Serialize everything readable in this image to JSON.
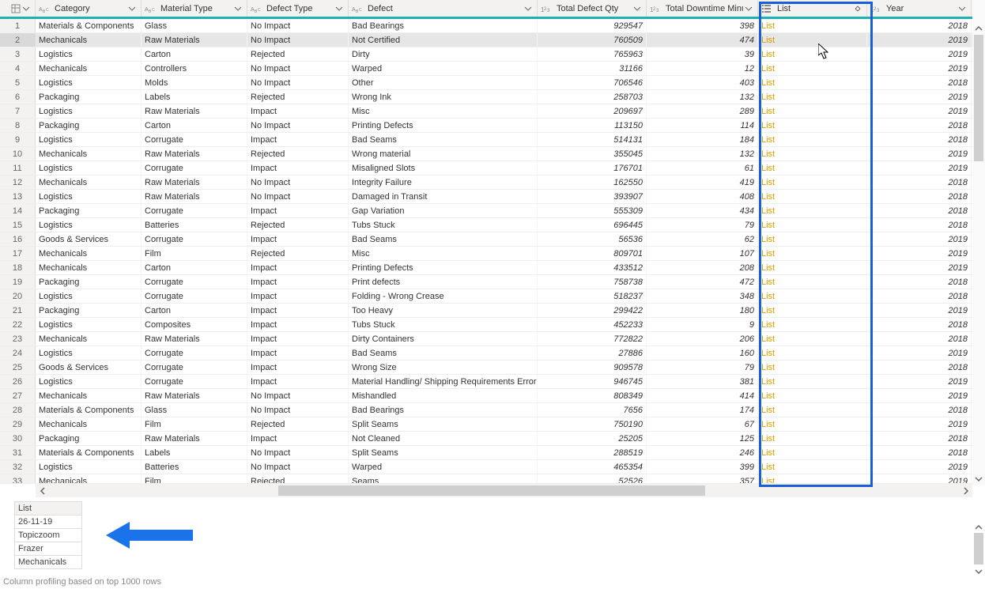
{
  "columns": {
    "category": "Category",
    "material": "Material Type",
    "defect_type": "Defect Type",
    "defect": "Defect",
    "qty": "Total Defect Qty",
    "downtime": "Total Downtime Minutes",
    "list": "List",
    "year": "Year"
  },
  "type_icon_text": {
    "text": "ABC",
    "num": "123",
    "list": "list"
  },
  "rows": [
    {
      "n": 1,
      "category": "Materials & Components",
      "material": "Glass",
      "defect_type": "No Impact",
      "defect": "Bad Bearings",
      "qty": "929547",
      "downtime": "398",
      "list": "List",
      "year": "2018"
    },
    {
      "n": 2,
      "category": "Mechanicals",
      "material": "Raw Materials",
      "defect_type": "No Impact",
      "defect": "Not Certified",
      "qty": "760509",
      "downtime": "474",
      "list": "List",
      "year": "2019"
    },
    {
      "n": 3,
      "category": "Logistics",
      "material": "Carton",
      "defect_type": "Rejected",
      "defect": "Dirty",
      "qty": "765963",
      "downtime": "39",
      "list": "List",
      "year": "2019"
    },
    {
      "n": 4,
      "category": "Mechanicals",
      "material": "Controllers",
      "defect_type": "No Impact",
      "defect": "Warped",
      "qty": "31166",
      "downtime": "12",
      "list": "List",
      "year": "2019"
    },
    {
      "n": 5,
      "category": "Logistics",
      "material": "Molds",
      "defect_type": "No Impact",
      "defect": "Other",
      "qty": "706546",
      "downtime": "403",
      "list": "List",
      "year": "2018"
    },
    {
      "n": 6,
      "category": "Packaging",
      "material": "Labels",
      "defect_type": "Rejected",
      "defect": "Wrong Ink",
      "qty": "258703",
      "downtime": "132",
      "list": "List",
      "year": "2019"
    },
    {
      "n": 7,
      "category": "Logistics",
      "material": "Raw Materials",
      "defect_type": "Impact",
      "defect": "Misc",
      "qty": "209697",
      "downtime": "289",
      "list": "List",
      "year": "2019"
    },
    {
      "n": 8,
      "category": "Packaging",
      "material": "Carton",
      "defect_type": "No Impact",
      "defect": "Printing Defects",
      "qty": "113150",
      "downtime": "114",
      "list": "List",
      "year": "2018"
    },
    {
      "n": 9,
      "category": "Logistics",
      "material": "Corrugate",
      "defect_type": "Impact",
      "defect": "Bad Seams",
      "qty": "514131",
      "downtime": "184",
      "list": "List",
      "year": "2018"
    },
    {
      "n": 10,
      "category": "Mechanicals",
      "material": "Raw Materials",
      "defect_type": "Rejected",
      "defect": "Wrong material",
      "qty": "355045",
      "downtime": "132",
      "list": "List",
      "year": "2019"
    },
    {
      "n": 11,
      "category": "Logistics",
      "material": "Corrugate",
      "defect_type": "Impact",
      "defect": "Misaligned Slots",
      "qty": "176701",
      "downtime": "61",
      "list": "List",
      "year": "2019"
    },
    {
      "n": 12,
      "category": "Mechanicals",
      "material": "Raw Materials",
      "defect_type": "No Impact",
      "defect": "Integrity Failure",
      "qty": "162550",
      "downtime": "419",
      "list": "List",
      "year": "2018"
    },
    {
      "n": 13,
      "category": "Logistics",
      "material": "Raw Materials",
      "defect_type": "No Impact",
      "defect": "Damaged in Transit",
      "qty": "393907",
      "downtime": "408",
      "list": "List",
      "year": "2018"
    },
    {
      "n": 14,
      "category": "Packaging",
      "material": "Corrugate",
      "defect_type": "Impact",
      "defect": "Gap Variation",
      "qty": "555309",
      "downtime": "434",
      "list": "List",
      "year": "2018"
    },
    {
      "n": 15,
      "category": "Logistics",
      "material": "Batteries",
      "defect_type": "Rejected",
      "defect": "Tubs Stuck",
      "qty": "696445",
      "downtime": "79",
      "list": "List",
      "year": "2018"
    },
    {
      "n": 16,
      "category": "Goods & Services",
      "material": "Corrugate",
      "defect_type": "Impact",
      "defect": "Bad Seams",
      "qty": "56536",
      "downtime": "62",
      "list": "List",
      "year": "2019"
    },
    {
      "n": 17,
      "category": "Mechanicals",
      "material": "Film",
      "defect_type": "Rejected",
      "defect": "Misc",
      "qty": "809701",
      "downtime": "107",
      "list": "List",
      "year": "2019"
    },
    {
      "n": 18,
      "category": "Mechanicals",
      "material": "Carton",
      "defect_type": "Impact",
      "defect": "Printing Defects",
      "qty": "433512",
      "downtime": "208",
      "list": "List",
      "year": "2019"
    },
    {
      "n": 19,
      "category": "Packaging",
      "material": "Corrugate",
      "defect_type": "Impact",
      "defect": "Print defects",
      "qty": "758738",
      "downtime": "472",
      "list": "List",
      "year": "2018"
    },
    {
      "n": 20,
      "category": "Logistics",
      "material": "Corrugate",
      "defect_type": "Impact",
      "defect": "Folding - Wrong Crease",
      "qty": "518237",
      "downtime": "348",
      "list": "List",
      "year": "2018"
    },
    {
      "n": 21,
      "category": "Packaging",
      "material": "Carton",
      "defect_type": "Impact",
      "defect": "Too Heavy",
      "qty": "299422",
      "downtime": "180",
      "list": "List",
      "year": "2019"
    },
    {
      "n": 22,
      "category": "Logistics",
      "material": "Composites",
      "defect_type": "Impact",
      "defect": "Tubs Stuck",
      "qty": "452233",
      "downtime": "9",
      "list": "List",
      "year": "2018"
    },
    {
      "n": 23,
      "category": "Mechanicals",
      "material": "Raw Materials",
      "defect_type": "Impact",
      "defect": "Dirty Containers",
      "qty": "772822",
      "downtime": "206",
      "list": "List",
      "year": "2018"
    },
    {
      "n": 24,
      "category": "Logistics",
      "material": "Corrugate",
      "defect_type": "Impact",
      "defect": "Bad Seams",
      "qty": "27886",
      "downtime": "160",
      "list": "List",
      "year": "2019"
    },
    {
      "n": 25,
      "category": "Goods & Services",
      "material": "Corrugate",
      "defect_type": "Impact",
      "defect": "Wrong  Size",
      "qty": "909578",
      "downtime": "79",
      "list": "List",
      "year": "2018"
    },
    {
      "n": 26,
      "category": "Logistics",
      "material": "Corrugate",
      "defect_type": "Impact",
      "defect": "Material Handling/ Shipping Requirements Error",
      "qty": "946745",
      "downtime": "381",
      "list": "List",
      "year": "2019"
    },
    {
      "n": 27,
      "category": "Mechanicals",
      "material": "Raw Materials",
      "defect_type": "No Impact",
      "defect": "Mishandled",
      "qty": "808349",
      "downtime": "414",
      "list": "List",
      "year": "2019"
    },
    {
      "n": 28,
      "category": "Materials & Components",
      "material": "Glass",
      "defect_type": "No Impact",
      "defect": "Bad Bearings",
      "qty": "7656",
      "downtime": "174",
      "list": "List",
      "year": "2018"
    },
    {
      "n": 29,
      "category": "Mechanicals",
      "material": "Film",
      "defect_type": "Rejected",
      "defect": "Split Seams",
      "qty": "750190",
      "downtime": "67",
      "list": "List",
      "year": "2019"
    },
    {
      "n": 30,
      "category": "Packaging",
      "material": "Raw Materials",
      "defect_type": "Impact",
      "defect": "Not Cleaned",
      "qty": "25205",
      "downtime": "125",
      "list": "List",
      "year": "2018"
    },
    {
      "n": 31,
      "category": "Materials & Components",
      "material": "Labels",
      "defect_type": "No Impact",
      "defect": "Split Seams",
      "qty": "288519",
      "downtime": "246",
      "list": "List",
      "year": "2018"
    },
    {
      "n": 32,
      "category": "Logistics",
      "material": "Batteries",
      "defect_type": "No Impact",
      "defect": "Warped",
      "qty": "465354",
      "downtime": "399",
      "list": "List",
      "year": "2019"
    },
    {
      "n": 33,
      "category": "Mechanicals",
      "material": "Film",
      "defect_type": "Rejected",
      "defect": "Seams",
      "qty": "52526",
      "downtime": "357",
      "list": "List",
      "year": "2019"
    }
  ],
  "preview": {
    "title": "List",
    "items": [
      "26-11-19",
      "Topiczoom",
      "Frazer",
      "Mechanicals"
    ]
  },
  "statusbar": "Column profiling based on top 1000 rows",
  "selected_row": 2
}
